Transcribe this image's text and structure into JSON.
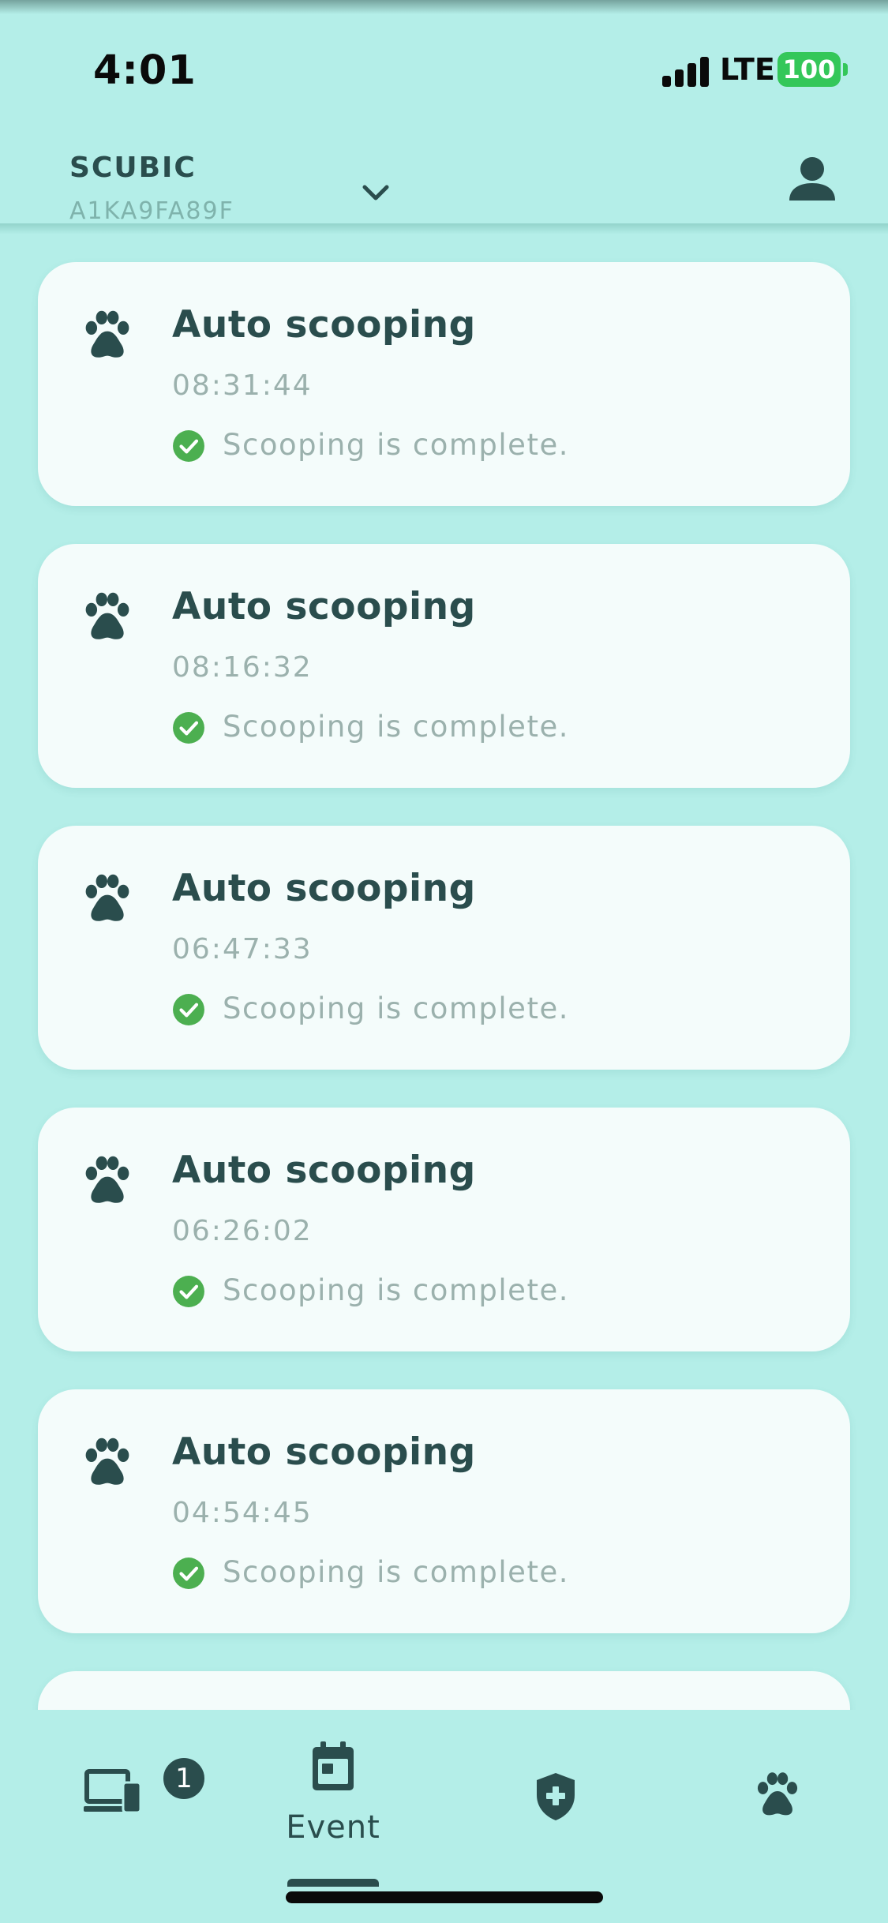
{
  "status_bar": {
    "time": "4:01",
    "network": "LTE",
    "battery": "100"
  },
  "header": {
    "device_name": "SCUBIC",
    "device_id": "A1KA9FA89F",
    "dropdown_icon": "chevron-down-icon",
    "profile_icon": "person-icon"
  },
  "events": [
    {
      "title": "Auto scooping",
      "time": "08:31:44",
      "status": "Scooping is complete.",
      "icon": "paw-icon",
      "status_icon": "check-circle-icon"
    },
    {
      "title": "Auto scooping",
      "time": "08:16:32",
      "status": "Scooping is complete.",
      "icon": "paw-icon",
      "status_icon": "check-circle-icon"
    },
    {
      "title": "Auto scooping",
      "time": "06:47:33",
      "status": "Scooping is complete.",
      "icon": "paw-icon",
      "status_icon": "check-circle-icon"
    },
    {
      "title": "Auto scooping",
      "time": "06:26:02",
      "status": "Scooping is complete.",
      "icon": "paw-icon",
      "status_icon": "check-circle-icon"
    },
    {
      "title": "Auto scooping",
      "time": "04:54:45",
      "status": "Scooping is complete.",
      "icon": "paw-icon",
      "status_icon": "check-circle-icon"
    }
  ],
  "bottom_nav": {
    "items": [
      {
        "icon": "devices-icon",
        "label": "",
        "badge": "1",
        "active": false
      },
      {
        "icon": "calendar-icon",
        "label": "Event",
        "active": true
      },
      {
        "icon": "shield-plus-icon",
        "label": "",
        "active": false
      },
      {
        "icon": "paw-icon",
        "label": "",
        "active": false
      }
    ]
  },
  "colors": {
    "background": "#b4eee8",
    "card": "#f4fcfb",
    "primary_text": "#2a4d4d",
    "secondary_text": "#9bb1ad",
    "success": "#4caf50",
    "battery": "#34c759"
  }
}
